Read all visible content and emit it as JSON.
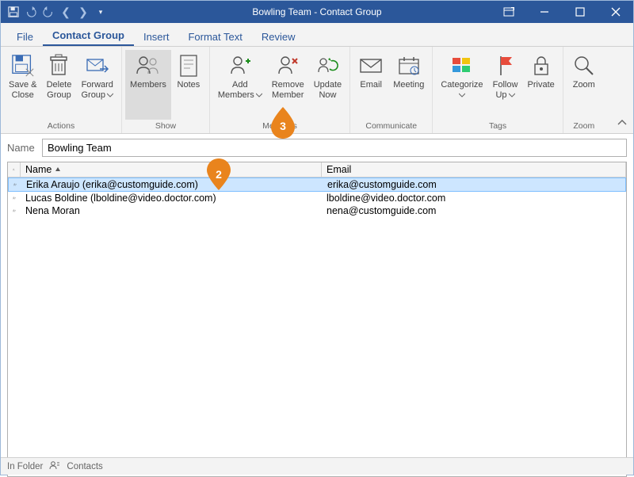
{
  "title": "Bowling Team - Contact Group",
  "tabs": {
    "file": "File",
    "contact_group": "Contact Group",
    "insert": "Insert",
    "format_text": "Format Text",
    "review": "Review"
  },
  "ribbon": {
    "groups": {
      "actions": {
        "label": "Actions",
        "save_close": "Save &\nClose",
        "delete_group": "Delete\nGroup",
        "forward_group": "Forward\nGroup"
      },
      "show": {
        "label": "Show",
        "members": "Members",
        "notes": "Notes"
      },
      "members": {
        "label": "Members",
        "add_members": "Add\nMembers",
        "remove_member": "Remove\nMember",
        "update_now": "Update\nNow"
      },
      "communicate": {
        "label": "Communicate",
        "email": "Email",
        "meeting": "Meeting"
      },
      "tags": {
        "label": "Tags",
        "categorize": "Categorize",
        "follow_up": "Follow\nUp",
        "private": "Private"
      },
      "zoom": {
        "label": "Zoom",
        "zoom": "Zoom"
      }
    }
  },
  "name_field": {
    "label": "Name",
    "value": "Bowling Team"
  },
  "list": {
    "headers": {
      "name": "Name",
      "email": "Email"
    },
    "rows": [
      {
        "name": "Erika Araujo (erika@customguide.com)",
        "email": "erika@customguide.com",
        "selected": true
      },
      {
        "name": "Lucas Boldine (lboldine@video.doctor.com)",
        "email": "lboldine@video.doctor.com",
        "selected": false
      },
      {
        "name": "Nena Moran",
        "email": "nena@customguide.com",
        "selected": false
      }
    ]
  },
  "status": {
    "in_folder": "In Folder",
    "contacts": "Contacts"
  },
  "callouts": {
    "c2": "2",
    "c3": "3"
  }
}
